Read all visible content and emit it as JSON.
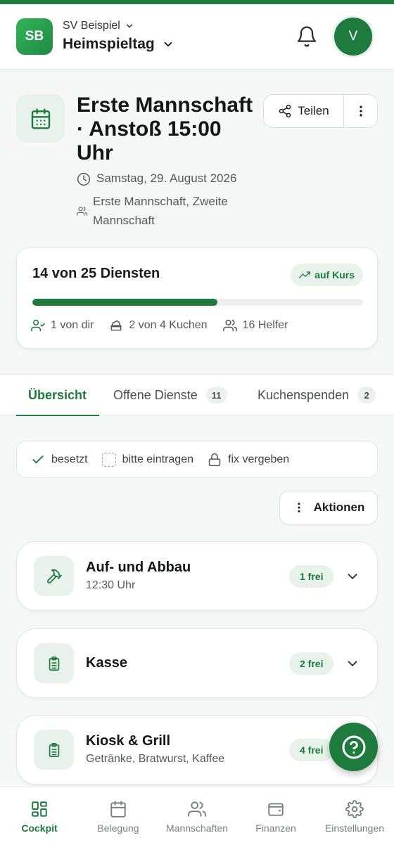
{
  "header": {
    "logo_text": "SB",
    "club_name": "SV Beispiel",
    "context_name": "Heimspieltag",
    "avatar_initial": "V"
  },
  "event": {
    "title": "Erste Mannschaft · Anstoß 15:00 Uhr",
    "date": "Samstag, 29. August 2026",
    "teams": "Erste Mannschaft, Zweite Mannschaft",
    "share_label": "Teilen"
  },
  "progress": {
    "summary": "14 von 25 Diensten",
    "filled": 14,
    "total": 25,
    "status_label": "auf Kurs",
    "stats": {
      "mine": "1 von dir",
      "cakes": "2 von 4 Kuchen",
      "helpers": "16 Helfer"
    }
  },
  "tabs": [
    {
      "label": "Übersicht",
      "count": ""
    },
    {
      "label": "Offene Dienste",
      "count": "11"
    },
    {
      "label": "Kuchenspenden",
      "count": "2"
    }
  ],
  "legend": {
    "taken": "besetzt",
    "open": "bitte eintragen",
    "fixed": "fix vergeben"
  },
  "actions_label": "Aktionen",
  "duties": [
    {
      "title": "Auf- und Abbau",
      "subtitle": "12:30 Uhr",
      "free": "1 frei",
      "icon": "hammer-icon"
    },
    {
      "title": "Kasse",
      "subtitle": "",
      "free": "2 frei",
      "icon": "clipboard-icon"
    },
    {
      "title": "Kiosk & Grill",
      "subtitle": "Getränke, Bratwurst, Kaffee",
      "free": "4 frei",
      "icon": "clipboard-icon"
    }
  ],
  "nav": [
    {
      "label": "Cockpit",
      "icon": "grid-icon"
    },
    {
      "label": "Belegung",
      "icon": "calendar-icon"
    },
    {
      "label": "Mannschaften",
      "icon": "users-icon"
    },
    {
      "label": "Finanzen",
      "icon": "wallet-icon"
    },
    {
      "label": "Einstellungen",
      "icon": "gear-icon"
    }
  ],
  "colors": {
    "primary": "#1e7a3d",
    "primary_soft": "#e6f2ea",
    "background": "#f6f7f7"
  }
}
